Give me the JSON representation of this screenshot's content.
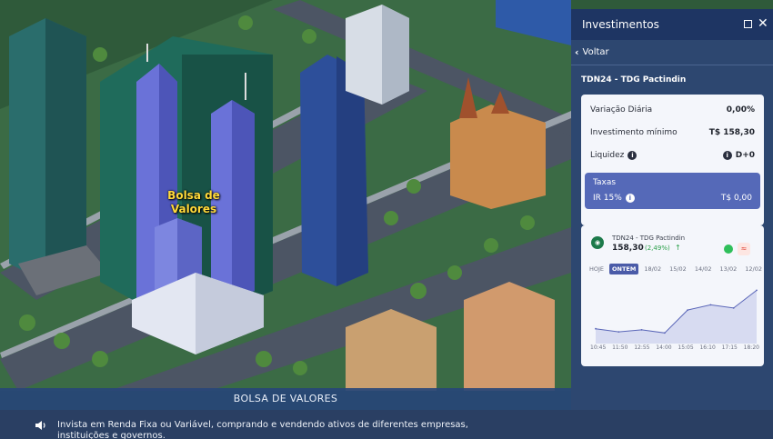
{
  "scene": {
    "building_label_line1": "Bolsa de",
    "building_label_line2": "Valores"
  },
  "location_bar": {
    "title": "BOLSA DE VALORES"
  },
  "narration": {
    "text": "Invista em Renda Fixa ou Variável, comprando e vendendo ativos de diferentes empresas, instituições e governos."
  },
  "panel": {
    "title": "Investimentos",
    "back_label": "Voltar",
    "asset_title": "TDN24 - TDG Pactindin",
    "rows": {
      "variacao_label": "Variação Diária",
      "variacao_value": "0,00%",
      "minimo_label": "Investimento mínimo",
      "minimo_value": "T$ 158,30",
      "liquidez_label": "Liquidez",
      "liquidez_value": "D+0"
    },
    "taxas": {
      "label": "Taxas",
      "ir_label": "IR 15%",
      "ir_value": "T$ 0,00"
    },
    "chart": {
      "asset": "TDN24 - TDG Pactindin",
      "price": "158,30",
      "change": "(2,49%)",
      "tabs": [
        "HOJE",
        "ONTEM",
        "18/02",
        "15/02",
        "14/02",
        "13/02",
        "12/02"
      ],
      "active_tab": 1
    }
  },
  "colors": {
    "panel_bg": "#2d4770",
    "header_bg": "#1e3563",
    "taxas_bg": "#5569b8",
    "positive": "#2ba04a",
    "line": "#5a66b8"
  },
  "icons": [
    "maximize-icon",
    "close-icon",
    "chevron-left-icon",
    "info-icon",
    "speaker-icon",
    "arrow-up-icon",
    "status-dot",
    "ticker-icon"
  ],
  "chart_data": {
    "type": "area",
    "x": [
      "10:45",
      "11:50",
      "12:55",
      "14:00",
      "15:05",
      "16:10",
      "17:15",
      "18:20"
    ],
    "y": [
      154.6,
      154.3,
      154.5,
      154.2,
      156.4,
      156.9,
      156.6,
      158.3
    ],
    "title": "",
    "xlabel": "",
    "ylabel": "",
    "grid": false
  }
}
